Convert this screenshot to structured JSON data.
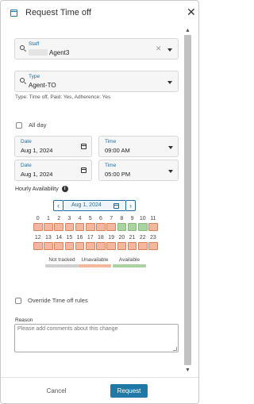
{
  "header": {
    "title": "Request Time off",
    "icon": "calendar-icon",
    "close_icon": "close-icon"
  },
  "staff": {
    "label": "Staff",
    "value": "Agent3"
  },
  "type": {
    "label": "Type",
    "value": "Agent-TO"
  },
  "type_hint": "Type: Time off, Paid: Yes, Adherence: Yes",
  "all_day": {
    "label": "All day",
    "checked": false
  },
  "start": {
    "date_label": "Date",
    "date": "Aug 1, 2024",
    "time_label": "Time",
    "time": "09:00 AM"
  },
  "end": {
    "date_label": "Date",
    "date": "Aug 1, 2024",
    "time_label": "Time",
    "time": "05:00 PM"
  },
  "hourly": {
    "label": "Hourly Availability",
    "date": "Aug 1, 2024",
    "prev_icon": "chevron-left-icon",
    "next_icon": "chevron-right-icon",
    "hours": [
      {
        "h": "0",
        "status": "unavailable"
      },
      {
        "h": "1",
        "status": "unavailable"
      },
      {
        "h": "2",
        "status": "unavailable"
      },
      {
        "h": "3",
        "status": "unavailable"
      },
      {
        "h": "4",
        "status": "unavailable"
      },
      {
        "h": "5",
        "status": "unavailable"
      },
      {
        "h": "6",
        "status": "unavailable"
      },
      {
        "h": "7",
        "status": "unavailable"
      },
      {
        "h": "8",
        "status": "available"
      },
      {
        "h": "9",
        "status": "available"
      },
      {
        "h": "10",
        "status": "available"
      },
      {
        "h": "11",
        "status": "unavailable"
      },
      {
        "h": "12",
        "status": "unavailable"
      },
      {
        "h": "13",
        "status": "unavailable"
      },
      {
        "h": "14",
        "status": "unavailable"
      },
      {
        "h": "15",
        "status": "unavailable"
      },
      {
        "h": "16",
        "status": "unavailable"
      },
      {
        "h": "17",
        "status": "unavailable"
      },
      {
        "h": "18",
        "status": "unavailable"
      },
      {
        "h": "19",
        "status": "unavailable"
      },
      {
        "h": "20",
        "status": "unavailable"
      },
      {
        "h": "21",
        "status": "unavailable"
      },
      {
        "h": "22",
        "status": "unavailable"
      },
      {
        "h": "23",
        "status": "unavailable"
      }
    ],
    "legend": [
      {
        "label": "Not tracked",
        "color": "#cfcfcf"
      },
      {
        "label": "Unavailable",
        "color": "#f2b79c"
      },
      {
        "label": "Available",
        "color": "#a9d3a0"
      }
    ]
  },
  "override": {
    "label": "Override Time off rules",
    "checked": false
  },
  "reason": {
    "label": "Reason",
    "placeholder": "Please add comments about this change"
  },
  "footer": {
    "cancel": "Cancel",
    "request": "Request"
  },
  "colors": {
    "accent": "#1f78a6",
    "unavailable": "#f2b79c",
    "available": "#a9d3a0",
    "not_tracked": "#cfcfcf"
  }
}
